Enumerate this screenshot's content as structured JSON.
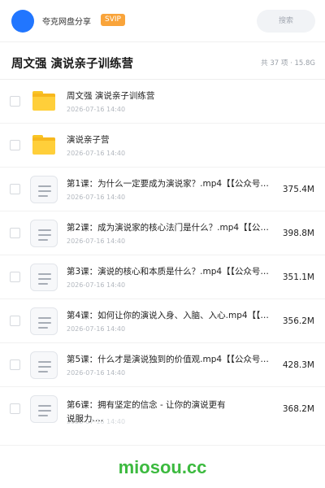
{
  "header": {
    "brand": "夸克网盘分享",
    "badge": "SVIP",
    "search_placeholder": "搜索"
  },
  "folder": {
    "title": "周文强 演说亲子训练营",
    "meta": "共 37 项 · 15.8G"
  },
  "items": [
    {
      "type": "folder",
      "icon": "folder-icon",
      "name": "周文强  演说亲子训练营",
      "date": "2026-07-16 14:40",
      "size": ""
    },
    {
      "type": "folder",
      "icon": "folder-icon",
      "name": "演说亲子营",
      "date": "2026-07-16 14:40",
      "size": ""
    },
    {
      "type": "file",
      "icon": "document-icon",
      "name": "第1课：为什么一定要成为演说家？.mp4【【公众号…",
      "date": "2026-07-16 14:40",
      "size": "375.4M"
    },
    {
      "type": "file",
      "icon": "document-icon",
      "name": "第2课：成为演说家的核心法门是什么？.mp4【【公…",
      "date": "2026-07-16 14:40",
      "size": "398.8M"
    },
    {
      "type": "file",
      "icon": "document-icon",
      "name": "第3课：演说的核心和本质是什么？.mp4【【公众号…",
      "date": "2026-07-16 14:40",
      "size": "351.1M"
    },
    {
      "type": "file",
      "icon": "document-icon",
      "name": "第4课：如何让你的演说入身、入脑、入心.mp4【【…",
      "date": "2026-07-16 14:40",
      "size": "356.2M"
    },
    {
      "type": "file",
      "icon": "document-icon",
      "name": "第5课：什么才是演说独到的价值观.mp4【【公众号…",
      "date": "2026-07-16 14:40",
      "size": "428.3M"
    },
    {
      "type": "file",
      "icon": "document-icon",
      "name": "第6课：拥有坚定的信念 - 让你的演说更有说服力.…",
      "date": "2026-07-16 14:40",
      "size": "368.2M"
    }
  ],
  "watermark": "miosou.cc",
  "colors": {
    "avatar": "#2176ff",
    "badge": "#f9a43a",
    "folder": "#ffcf3a",
    "watermark": "#3cba3f"
  }
}
